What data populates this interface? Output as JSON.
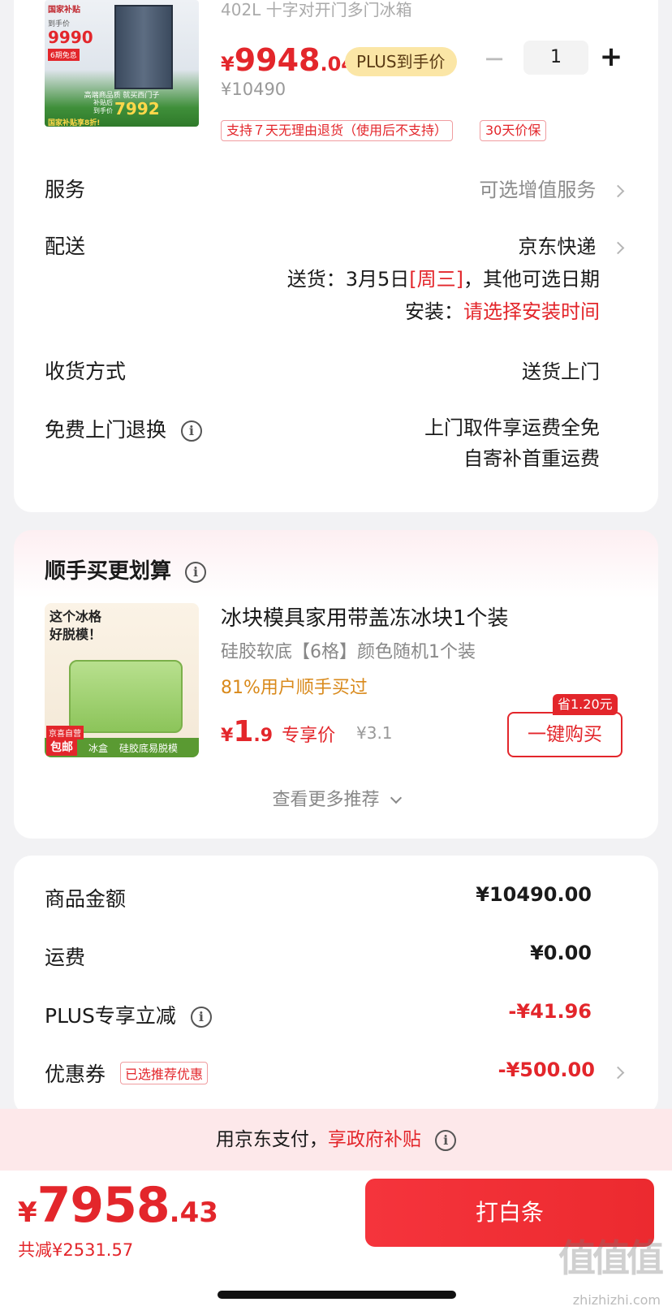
{
  "product": {
    "title_partial": "402L 十字对开门多门冰箱",
    "thumb": {
      "tag1": "国家补贴",
      "price_label": "到手价",
      "price": "9990",
      "gift": "6期免息",
      "band": "高端商品质 就买西门子",
      "subsidy": "补贴后到手价",
      "subsidy_price": "7992",
      "bottom": "国家补贴享8折!"
    },
    "price_symbol": "¥",
    "price_int": "9948",
    "price_dec": ".04",
    "plus_badge": "PLUS到手价",
    "original_price": "¥10490",
    "quantity": "1",
    "minus": "−",
    "plus": "+",
    "tag_return": "支持７天无理由退货（使用后不支持）",
    "tag_price_protect": "30天价保"
  },
  "rows": {
    "service_label": "服务",
    "service_value": "可选增值服务",
    "delivery_label": "配送",
    "delivery_value": "京东快递",
    "delivery_date_prefix": "送货：3月5日",
    "delivery_date_day": "[周三]",
    "delivery_date_suffix": "，其他可选日期",
    "install_prefix": "安装：",
    "install_value": "请选择安装时间",
    "receive_label": "收货方式",
    "receive_value": "送货上门",
    "return_label": "免费上门退换",
    "return_value_1": "上门取件享运费全免",
    "return_value_2": "自寄补首重运费"
  },
  "recommend": {
    "title": "顺手买更划算",
    "item_title": "冰块模具家用带盖冻冰块1个装",
    "item_sub": "硅胶软底【6格】颜色随机1个装",
    "item_stat": "81%用户顺手买过",
    "price_symbol": "¥",
    "price_int": "1",
    "price_dec": ".9",
    "price_tag": "专享价",
    "old_price": "¥3.1",
    "save_badge": "省1.20元",
    "buy_button": "一键购买",
    "thumb_text_1": "这个冰格",
    "thumb_text_2": "好脱模！",
    "thumb_badge_1": "京喜自营",
    "thumb_badge_2": "包邮",
    "thumb_badge_3": "冰盒",
    "thumb_badge_4": "硅胶底易脱模",
    "more": "查看更多推荐"
  },
  "summary": {
    "goods_label": "商品金额",
    "goods_value": "¥10490.00",
    "ship_label": "运费",
    "ship_value": "¥0.00",
    "plus_label": "PLUS专享立减",
    "plus_value": "-¥41.96",
    "coupon_label": "优惠券",
    "coupon_tag": "已选推荐优惠",
    "coupon_value": "-¥500.00"
  },
  "banner": {
    "prefix": "用京东支付，",
    "highlight": "享政府补贴"
  },
  "footer": {
    "price_symbol": "¥",
    "price_int": "7958",
    "price_dec": ".43",
    "saved": "共减¥2531.57",
    "pay_button": "打白条"
  },
  "watermark": {
    "text": "值值值",
    "url": "zhizhizhi.com"
  },
  "colors": {
    "accent": "#e3262b",
    "plus_gold": "#fbe6a6"
  }
}
